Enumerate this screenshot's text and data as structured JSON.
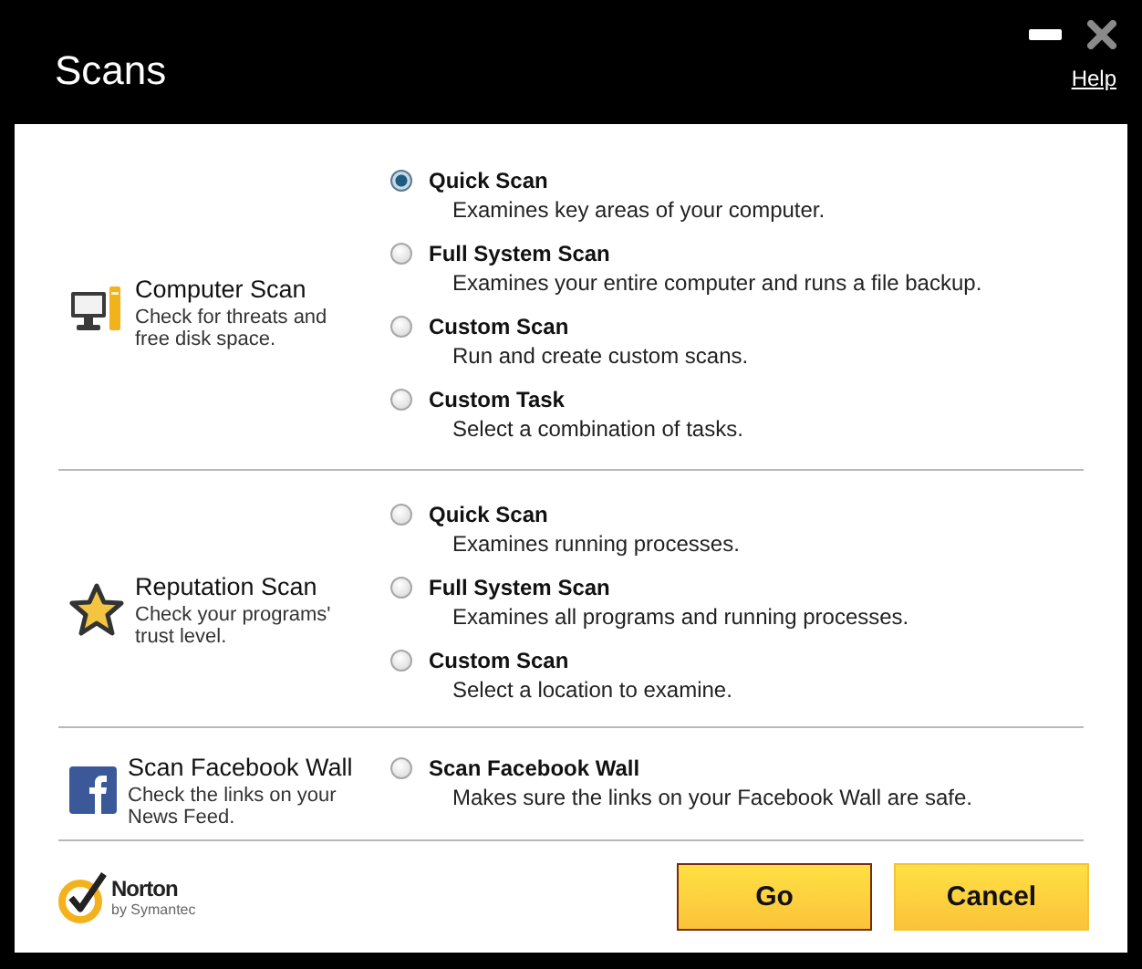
{
  "window": {
    "title": "Scans",
    "help_link": "Help"
  },
  "sections": [
    {
      "kind": "computer",
      "title": "Computer Scan",
      "description": "Check for threats and free disk space.",
      "options": [
        {
          "label": "Quick Scan",
          "description": "Examines key areas of your computer.",
          "selected": true
        },
        {
          "label": "Full System Scan",
          "description": "Examines your entire computer and runs a file backup.",
          "selected": false
        },
        {
          "label": "Custom Scan",
          "description": "Run and create custom scans.",
          "selected": false
        },
        {
          "label": "Custom Task",
          "description": "Select a combination of tasks.",
          "selected": false
        }
      ]
    },
    {
      "kind": "star",
      "title": "Reputation Scan",
      "description": "Check your programs' trust level.",
      "options": [
        {
          "label": "Quick Scan",
          "description": "Examines running processes.",
          "selected": false
        },
        {
          "label": "Full System Scan",
          "description": "Examines all programs and running processes.",
          "selected": false
        },
        {
          "label": "Custom Scan",
          "description": "Select a location to examine.",
          "selected": false
        }
      ]
    },
    {
      "kind": "facebook",
      "title": "Scan Facebook Wall",
      "description": "Check the links on your News Feed.",
      "options": [
        {
          "label": "Scan Facebook Wall",
          "description": "Makes sure the links on your Facebook Wall are safe.",
          "selected": false
        }
      ]
    }
  ],
  "logo": {
    "name": "Norton",
    "byline": "by Symantec"
  },
  "buttons": [
    {
      "label": "Go",
      "default": true
    },
    {
      "label": "Cancel",
      "default": false
    }
  ]
}
